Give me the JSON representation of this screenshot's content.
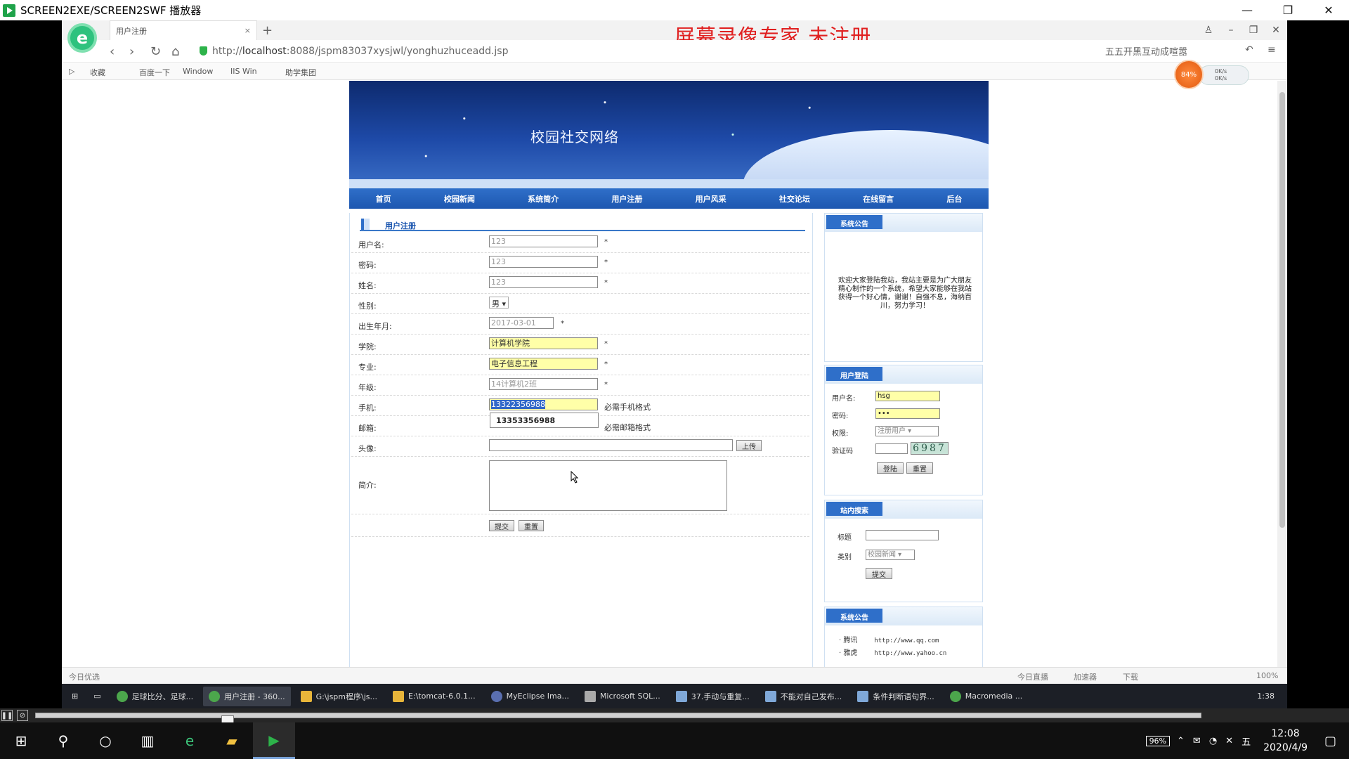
{
  "player": {
    "title": "SCREEN2EXE/SCREEN2SWF 播放器",
    "minimize": "—",
    "restore": "❐",
    "close": "✕"
  },
  "browser": {
    "tab_title": "用户注册",
    "tab_close": "×",
    "new_tab": "+",
    "watermark": "屏幕录像专家  未注册",
    "url_prefix": "http://",
    "url_host": "localhost",
    "url_rest": ":8088/jspm83037xysjwl/yonghuzhuceadd.jsp",
    "search_placeholder": "五五开黑互动成喧嚣",
    "bookmarks": [
      "收藏",
      "百度一下",
      "Window",
      "IIS Win",
      "助学集团"
    ],
    "speed_percent": "84%",
    "speed_up": "0K/s",
    "speed_down": "0K/s",
    "status_left": "今日优选",
    "status_right": [
      "今日直播",
      "加速器",
      "下载",
      "100%"
    ]
  },
  "site": {
    "title": "校园社交网络",
    "nav": [
      "首页",
      "校园新闻",
      "系统简介",
      "用户注册",
      "用户风采",
      "社交论坛",
      "在线留言",
      "后台"
    ],
    "register": {
      "heading": "用户注册",
      "fields": [
        {
          "label": "用户名:",
          "value": "123",
          "suffix": "*"
        },
        {
          "label": "密码:",
          "value": "123",
          "suffix": "*"
        },
        {
          "label": "姓名:",
          "value": "123",
          "suffix": "*"
        },
        {
          "label": "性别:",
          "value": "男 ▾",
          "suffix": ""
        },
        {
          "label": "出生年月:",
          "value": "2017-03-01",
          "suffix": "*"
        },
        {
          "label": "学院:",
          "value": "计算机学院",
          "suffix": "*"
        },
        {
          "label": "专业:",
          "value": "电子信息工程",
          "suffix": "*"
        },
        {
          "label": "年级:",
          "value": "14计算机2班",
          "suffix": "*"
        },
        {
          "label": "手机:",
          "value": "13322356988",
          "suffix": "必需手机格式"
        },
        {
          "label": "邮箱:",
          "value": "",
          "suffix": "必需邮箱格式"
        },
        {
          "label": "头像:",
          "value": "",
          "suffix": ""
        },
        {
          "label": "简介:",
          "value": "",
          "suffix": ""
        }
      ],
      "autocomplete": "13353356988",
      "upload_btn": "上传",
      "submit_btn": "提交",
      "reset_btn": "重置"
    },
    "notice": {
      "heading": "系统公告",
      "text": "欢迎大家登陆我站，我站主要是为广大朋友精心制作的一个系统，希望大家能够在我站获得一个好心情，谢谢！自强不息，海纳百川，努力学习！"
    },
    "login": {
      "heading": "用户登陆",
      "user_label": "用户名:",
      "user_value": "hsg",
      "pwd_label": "密码:",
      "pwd_value": "•••",
      "role_label": "权限:",
      "role_value": "注册用户 ▾",
      "captcha_label": "验证码",
      "captcha_value": "6987",
      "login_btn": "登陆",
      "reset_btn": "重置"
    },
    "search": {
      "heading": "站内搜索",
      "title_label": "标题",
      "type_label": "类别",
      "type_value": "校园新闻 ▾",
      "submit_btn": "提交"
    },
    "links": {
      "heading": "系统公告",
      "items": [
        {
          "name": "腾讯",
          "url": "http://www.qq.com"
        },
        {
          "name": "雅虎",
          "url": "http://www.yahoo.cn"
        }
      ]
    }
  },
  "inner_taskbar": [
    "足球比分、足球...",
    "用户注册 - 360...",
    "G:\\jspm程序\\js...",
    "E:\\tomcat-6.0.1...",
    "MyEclipse Ima...",
    "Microsoft SQL...",
    "37.手动与重复...",
    "不能对自己发布...",
    "条件判断语句界...",
    "Macromedia ..."
  ],
  "inner_clock": "1:38",
  "win_taskbar": {
    "battery": "96%",
    "time": "12:08",
    "date": "2020/4/9",
    "ime": "五"
  }
}
